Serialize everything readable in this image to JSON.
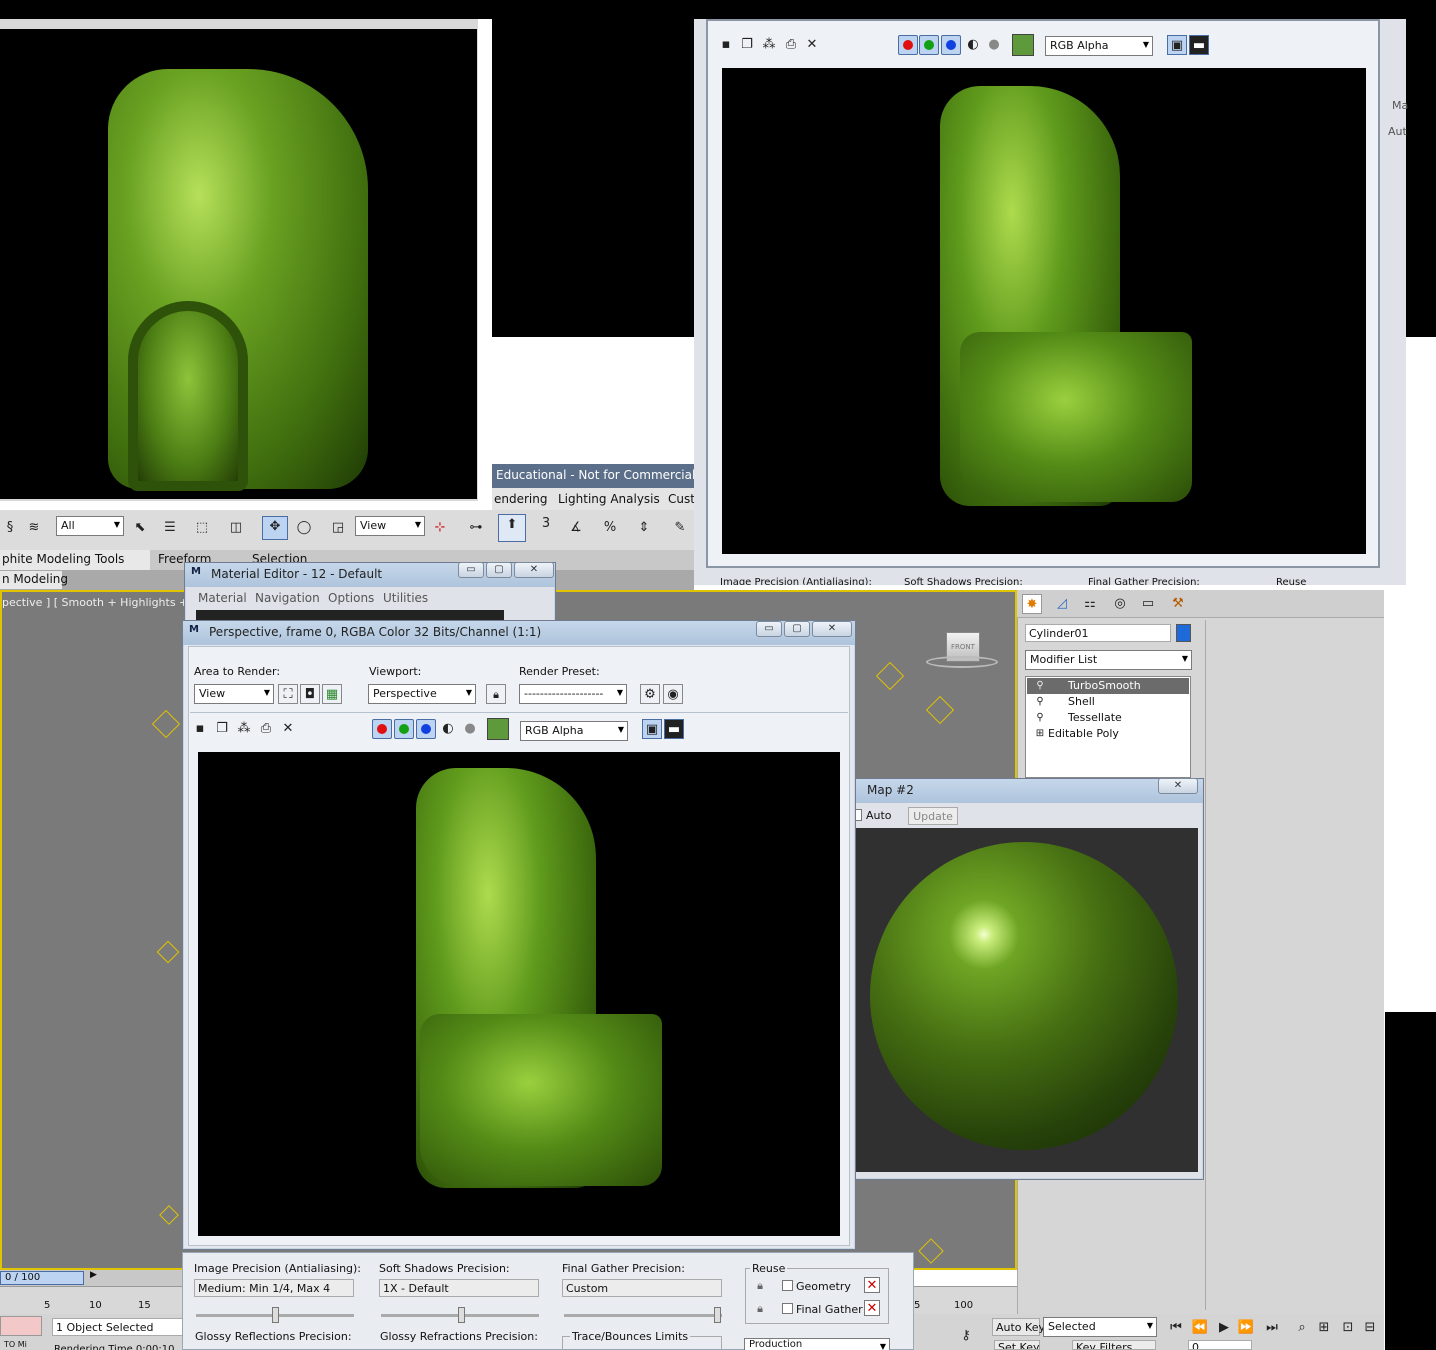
{
  "top_left_render": {},
  "top_right_window": {
    "channel_select": "RGB Alpha",
    "side_label_1": "Ma",
    "side_label_2": "Aut",
    "bottom_cut_1": "Image Precision (Antialiasing):",
    "bottom_cut_2": "Soft Shadows Precision:",
    "bottom_cut_3": "Final Gather Precision:",
    "bottom_cut_4": "Reuse"
  },
  "max_background": {
    "edu_banner": "Educational - Not for Commercial Use",
    "menus": [
      "endering",
      "Lighting Analysis",
      "Custo"
    ],
    "toolbar_all": "All",
    "toolbar_view": "View",
    "toolbar_snap": "3",
    "ribbon_tabs": [
      "phite Modeling Tools",
      "Freeform",
      "Selection"
    ],
    "ribbon_sub": "n Modeling",
    "viewport_label": "pective ] [ Smooth + Highlights + Edge",
    "viewcube_label": "FRONT",
    "time_slider": "0 / 100",
    "ruler_ticks": [
      "5",
      "10",
      "15"
    ],
    "ruler_right": [
      "5",
      "100"
    ],
    "status_left": "1 Object Selected",
    "status_left_sub": "TO  Mi",
    "status_cut": "Rendering Time 0:00:10",
    "auto_key": "Auto Key",
    "set_key": "Set Key",
    "key_mode": "Selected",
    "key_filters": "Key Filters...",
    "frame_field": "0"
  },
  "command_panel": {
    "object_name": "Cylinder01",
    "object_color": "#1d6ad8",
    "modifier_list": "Modifier List",
    "stack": [
      "TurboSmooth",
      "Shell",
      "Tessellate",
      "Editable Poly"
    ]
  },
  "material_editor": {
    "title": "Material Editor - 12 - Default",
    "menus": [
      "Material",
      "Navigation",
      "Options",
      "Utilities"
    ]
  },
  "render_window": {
    "title": "Perspective, frame 0, RGBA Color 32 Bits/Channel (1:1)",
    "area_label": "Area to Render:",
    "area_value": "View",
    "viewport_label": "Viewport:",
    "viewport_value": "Perspective",
    "preset_label": "Render Preset:",
    "preset_value": "--------------------",
    "channel_select": "RGB Alpha",
    "swatch_color": "#5e9a3b"
  },
  "render_settings": {
    "image_precision_label": "Image Precision (Antialiasing):",
    "image_precision_value": "Medium: Min 1/4, Max 4",
    "soft_shadows_label": "Soft Shadows Precision:",
    "soft_shadows_value": "1X - Default",
    "final_gather_label": "Final Gather Precision:",
    "final_gather_value": "Custom",
    "reuse_label": "Reuse",
    "reuse_geometry": "Geometry",
    "reuse_final_gather": "Final Gather",
    "glossy_reflections": "Glossy Reflections Precision:",
    "glossy_refractions": "Glossy Refractions Precision:",
    "trace_bounces": "Trace/Bounces Limits",
    "production": "Production"
  },
  "map_window": {
    "title": "Map #2",
    "auto": "Auto",
    "update": "Update"
  }
}
